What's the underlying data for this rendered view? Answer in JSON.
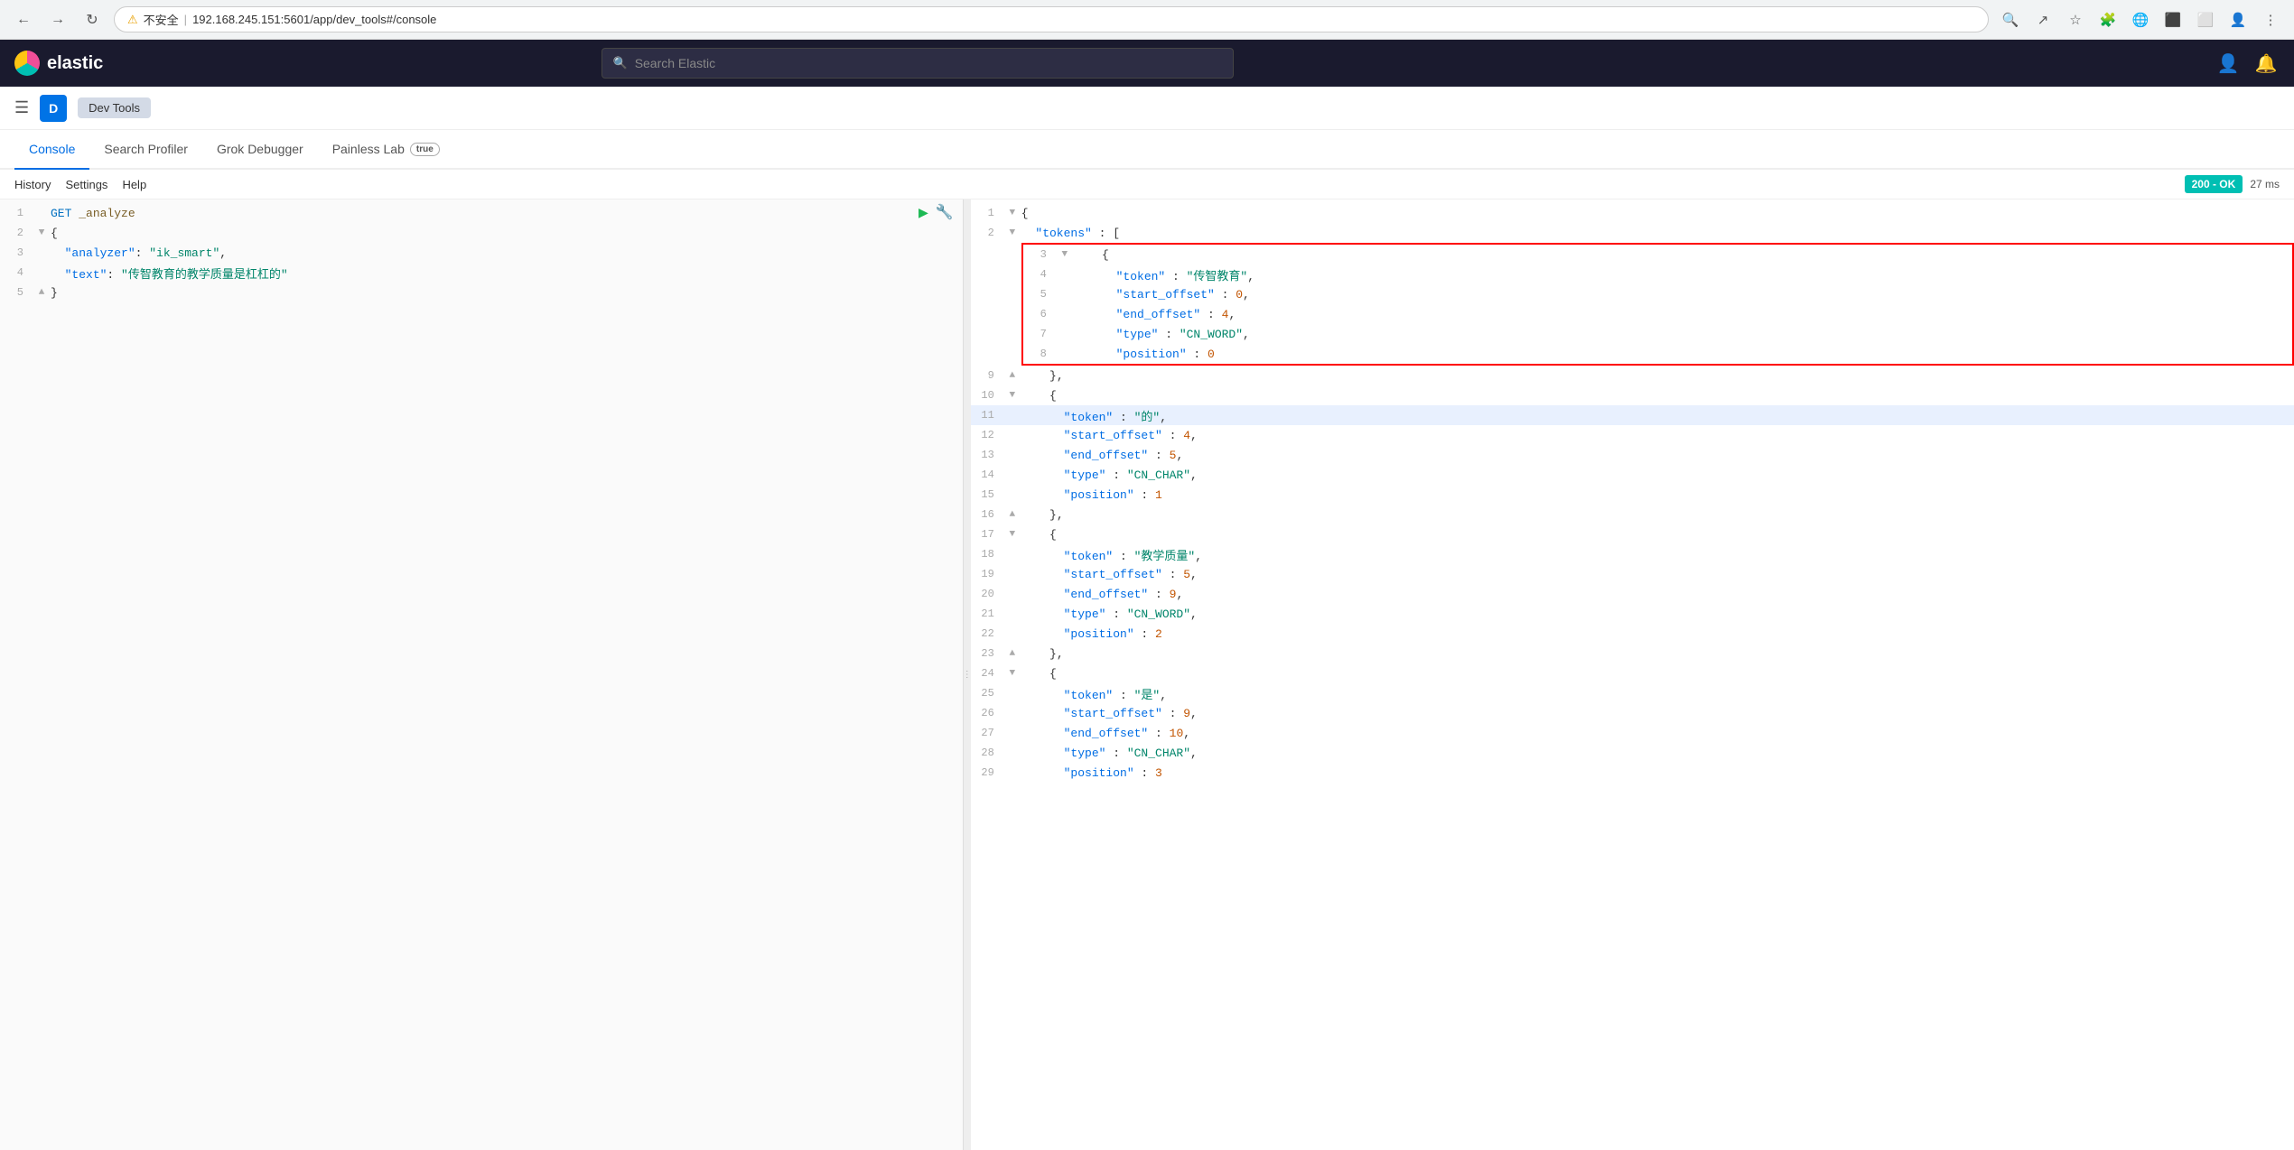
{
  "browser": {
    "url": "192.168.245.151:5601/app/dev_tools#/console",
    "security_warning": "不安全",
    "back_label": "←",
    "forward_label": "→",
    "reload_label": "↻"
  },
  "header": {
    "logo_text": "elastic",
    "search_placeholder": "Search Elastic"
  },
  "toolbar": {
    "app_label": "Dev Tools"
  },
  "tabs": [
    {
      "id": "console",
      "label": "Console",
      "active": true
    },
    {
      "id": "search-profiler",
      "label": "Search Profiler",
      "active": false
    },
    {
      "id": "grok-debugger",
      "label": "Grok Debugger",
      "active": false
    },
    {
      "id": "painless-lab",
      "label": "Painless Lab",
      "active": false,
      "beta": true
    }
  ],
  "secondary_toolbar": {
    "history_label": "History",
    "settings_label": "Settings",
    "help_label": "Help",
    "status_code": "200 - OK",
    "status_time": "27 ms"
  },
  "left_panel": {
    "lines": [
      {
        "num": "1",
        "gutter": "",
        "content": "GET _analyze",
        "highlight": false
      },
      {
        "num": "2",
        "gutter": "▼",
        "content": "{",
        "highlight": false
      },
      {
        "num": "3",
        "gutter": "",
        "content": "  \"analyzer\": \"ik_smart\",",
        "highlight": false
      },
      {
        "num": "4",
        "gutter": "",
        "content": "  \"text\": \"传智教育的教学质量是杠杠的\"",
        "highlight": false
      },
      {
        "num": "5",
        "gutter": "▲",
        "content": "}",
        "highlight": false
      }
    ]
  },
  "right_panel": {
    "lines": [
      {
        "num": "1",
        "gutter": "▼",
        "content": "{",
        "highlight": false,
        "red_border_start": false
      },
      {
        "num": "2",
        "gutter": "▼",
        "content": "  \"tokens\" : [",
        "highlight": false
      },
      {
        "num": "3",
        "gutter": "▼",
        "content": "    {",
        "highlight": false,
        "red_border_start": true
      },
      {
        "num": "4",
        "gutter": "",
        "content": "      \"token\" : \"传智教育\",",
        "highlight": false
      },
      {
        "num": "5",
        "gutter": "",
        "content": "      \"start_offset\" : 0,",
        "highlight": false
      },
      {
        "num": "6",
        "gutter": "",
        "content": "      \"end_offset\" : 4,",
        "highlight": false
      },
      {
        "num": "7",
        "gutter": "",
        "content": "      \"type\" : \"CN_WORD\",",
        "highlight": false
      },
      {
        "num": "8",
        "gutter": "",
        "content": "      \"position\" : 0",
        "highlight": false,
        "red_border_end": true
      },
      {
        "num": "9",
        "gutter": "▲",
        "content": "    },",
        "highlight": false
      },
      {
        "num": "10",
        "gutter": "▼",
        "content": "    {",
        "highlight": false
      },
      {
        "num": "11",
        "gutter": "",
        "content": "      \"token\" : \"的\",",
        "highlight": true
      },
      {
        "num": "12",
        "gutter": "",
        "content": "      \"start_offset\" : 4,",
        "highlight": false
      },
      {
        "num": "13",
        "gutter": "",
        "content": "      \"end_offset\" : 5,",
        "highlight": false
      },
      {
        "num": "14",
        "gutter": "",
        "content": "      \"type\" : \"CN_CHAR\",",
        "highlight": false
      },
      {
        "num": "15",
        "gutter": "",
        "content": "      \"position\" : 1",
        "highlight": false
      },
      {
        "num": "16",
        "gutter": "▲",
        "content": "    },",
        "highlight": false
      },
      {
        "num": "17",
        "gutter": "▼",
        "content": "    {",
        "highlight": false
      },
      {
        "num": "18",
        "gutter": "",
        "content": "      \"token\" : \"教学质量\",",
        "highlight": false
      },
      {
        "num": "19",
        "gutter": "",
        "content": "      \"start_offset\" : 5,",
        "highlight": false
      },
      {
        "num": "20",
        "gutter": "",
        "content": "      \"end_offset\" : 9,",
        "highlight": false
      },
      {
        "num": "21",
        "gutter": "",
        "content": "      \"type\" : \"CN_WORD\",",
        "highlight": false
      },
      {
        "num": "22",
        "gutter": "",
        "content": "      \"position\" : 2",
        "highlight": false
      },
      {
        "num": "23",
        "gutter": "▲",
        "content": "    },",
        "highlight": false
      },
      {
        "num": "24",
        "gutter": "▼",
        "content": "    {",
        "highlight": false
      },
      {
        "num": "25",
        "gutter": "",
        "content": "      \"token\" : \"是\",",
        "highlight": false
      },
      {
        "num": "26",
        "gutter": "",
        "content": "      \"start_offset\" : 9,",
        "highlight": false
      },
      {
        "num": "27",
        "gutter": "",
        "content": "      \"end_offset\" : 10,",
        "highlight": false
      },
      {
        "num": "28",
        "gutter": "",
        "content": "      \"type\" : \"CN_CHAR\",",
        "highlight": false
      },
      {
        "num": "29",
        "gutter": "",
        "content": "      \"position\" : 3",
        "highlight": false
      }
    ]
  }
}
